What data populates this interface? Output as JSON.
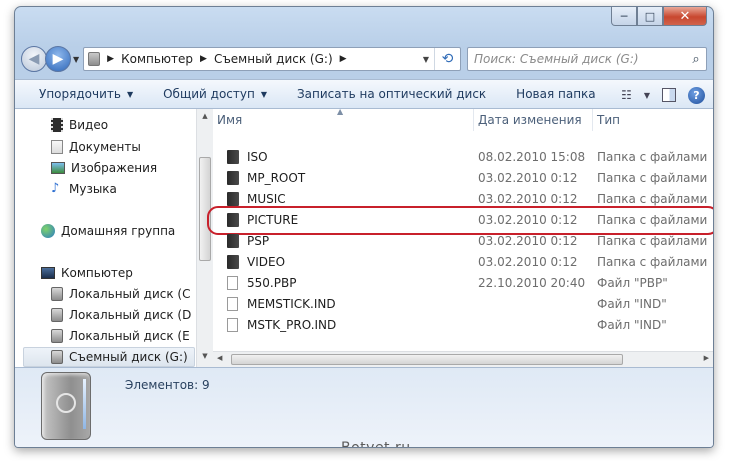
{
  "window": {
    "caption_buttons": {
      "minimize": "─",
      "maximize": "□",
      "close": "✕"
    }
  },
  "address_bar": {
    "crumbs": [
      "Компьютер",
      "Съемный диск (G:)"
    ],
    "search_placeholder": "Поиск: Съемный диск (G:)"
  },
  "toolbar": {
    "organize": "Упорядочить",
    "share": "Общий доступ",
    "burn": "Записать на оптический диск",
    "new_folder": "Новая папка"
  },
  "nav_pane": {
    "libraries": [
      {
        "label": "Видео",
        "icon": "video-icon"
      },
      {
        "label": "Документы",
        "icon": "documents-icon"
      },
      {
        "label": "Изображения",
        "icon": "pictures-icon"
      },
      {
        "label": "Музыка",
        "icon": "music-icon"
      }
    ],
    "homegroup": "Домашняя группа",
    "computer": "Компьютер",
    "drives": [
      "Локальный диск (C",
      "Локальный диск (D",
      "Локальный диск (E",
      "Съемный диск (G:)"
    ],
    "selected_drive_index": 3
  },
  "columns": {
    "name": "Имя",
    "date": "Дата изменения",
    "type": "Тип"
  },
  "files": [
    {
      "name": "ISO",
      "date": "08.02.2010 15:08",
      "type": "Папка с файлами",
      "kind": "folder"
    },
    {
      "name": "MP_ROOT",
      "date": "03.02.2010 0:12",
      "type": "Папка с файлами",
      "kind": "folder"
    },
    {
      "name": "MUSIC",
      "date": "03.02.2010 0:12",
      "type": "Папка с файлами",
      "kind": "folder"
    },
    {
      "name": "PICTURE",
      "date": "03.02.2010 0:12",
      "type": "Папка с файлами",
      "kind": "folder",
      "highlighted": true
    },
    {
      "name": "PSP",
      "date": "03.02.2010 0:12",
      "type": "Папка с файлами",
      "kind": "folder"
    },
    {
      "name": "VIDEO",
      "date": "03.02.2010 0:12",
      "type": "Папка с файлами",
      "kind": "folder"
    },
    {
      "name": "550.PBP",
      "date": "22.10.2010 20:40",
      "type": "Файл \"PBP\"",
      "kind": "file"
    },
    {
      "name": "MEMSTICK.IND",
      "date": "",
      "type": "Файл \"IND\"",
      "kind": "file"
    },
    {
      "name": "MSTK_PRO.IND",
      "date": "",
      "type": "Файл \"IND\"",
      "kind": "file"
    }
  ],
  "details": {
    "count_text": "Элементов: 9"
  },
  "watermark": "Botvet.ru",
  "colors": {
    "highlight_ring": "#c8202b",
    "toolbar_text": "#1e3a5f"
  }
}
